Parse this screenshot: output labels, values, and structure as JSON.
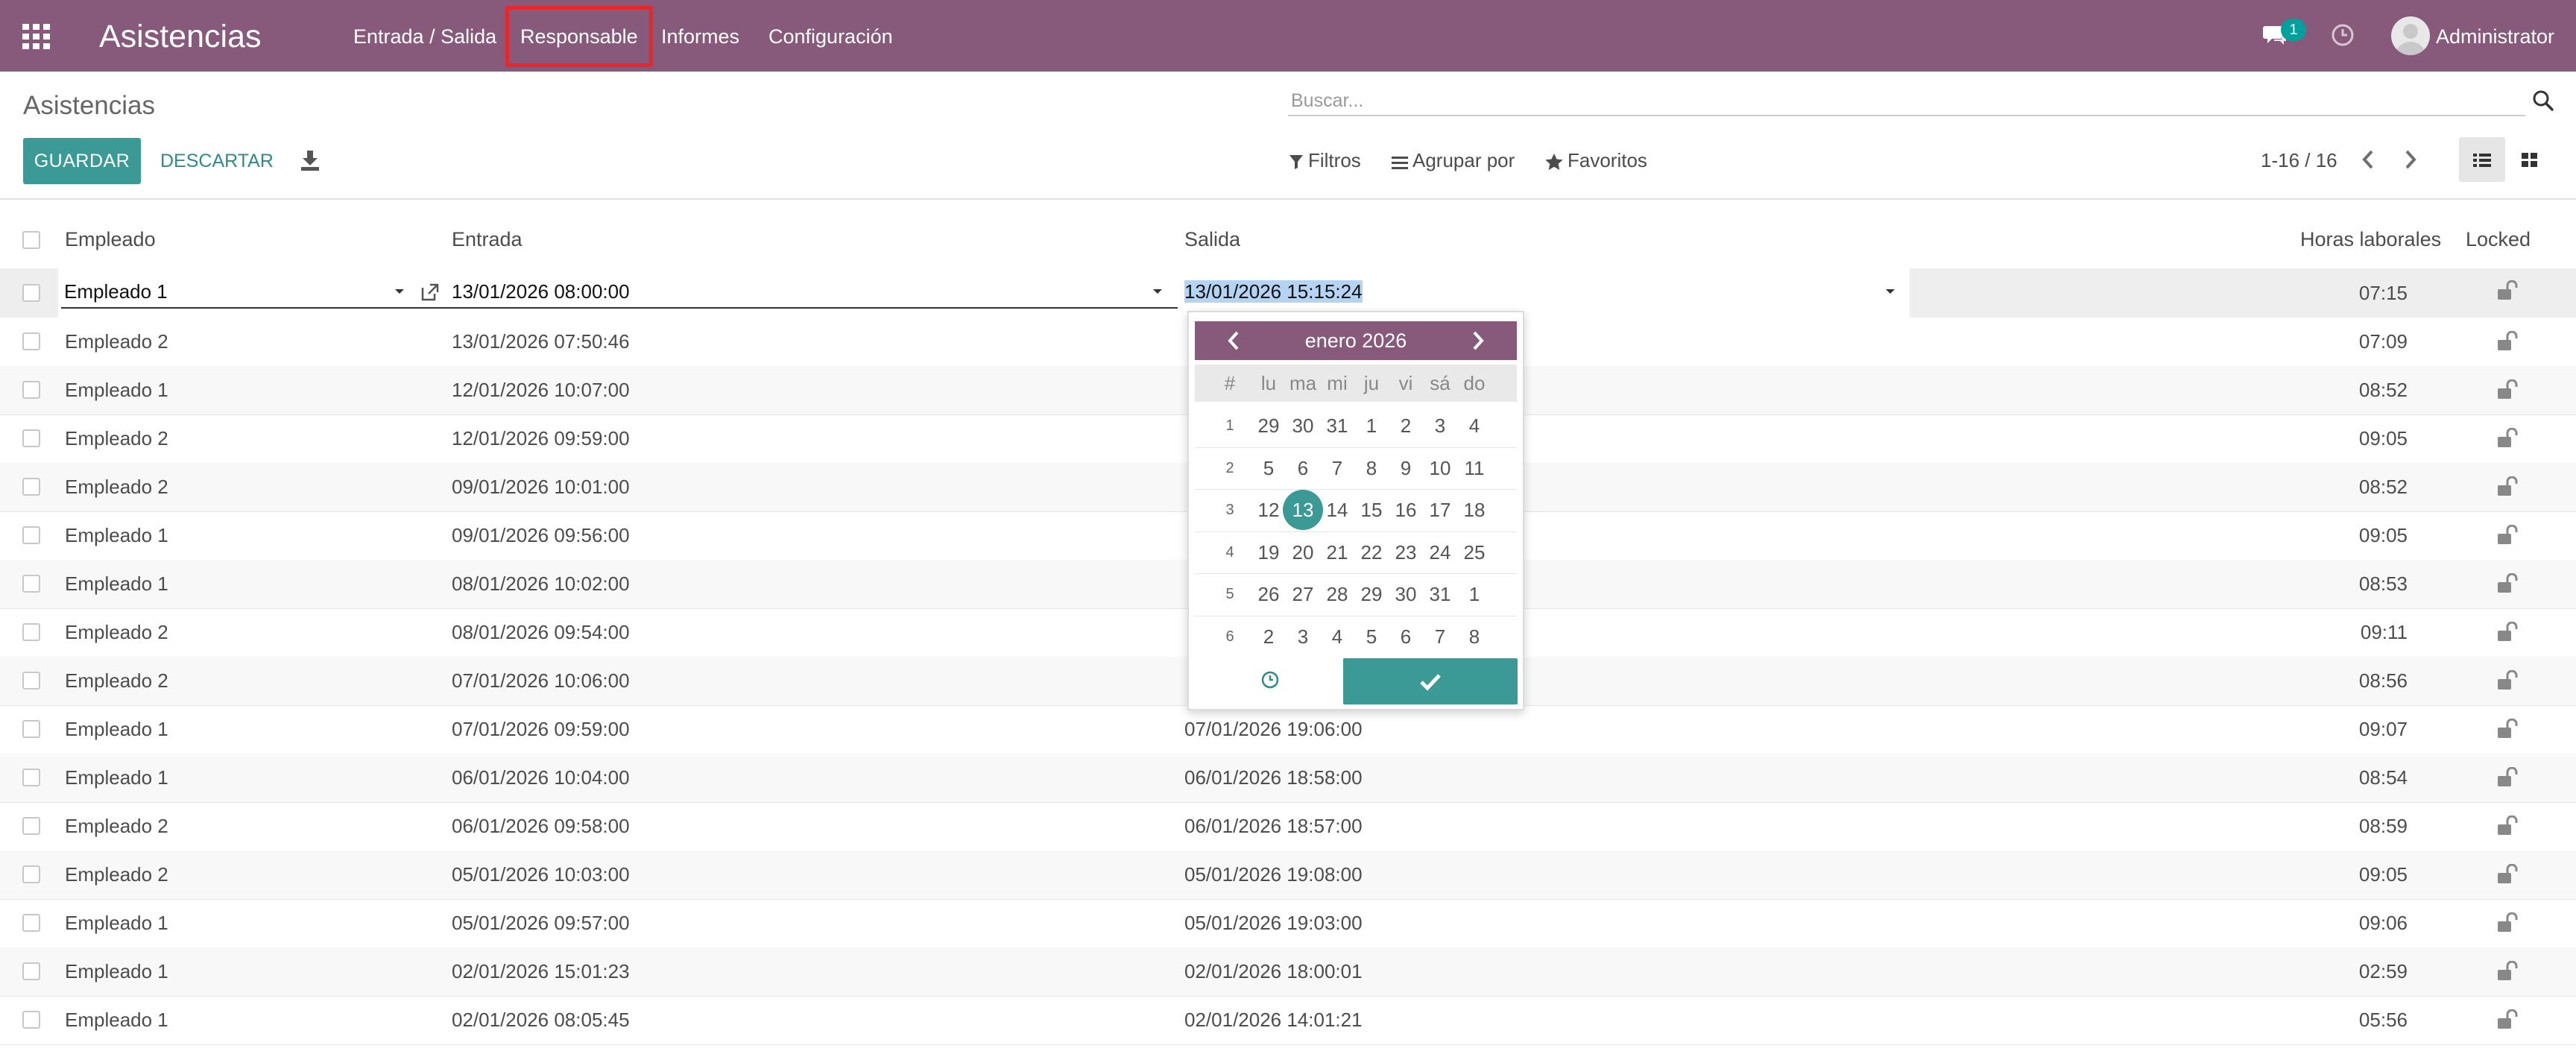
{
  "navbar": {
    "app_title": "Asistencias",
    "menu": [
      "Entrada / Salida",
      "Responsable",
      "Informes",
      "Configuración"
    ],
    "highlighted_menu": "Responsable",
    "chat_badge": "1",
    "user": "Administrator"
  },
  "control_panel": {
    "breadcrumb": "Asistencias",
    "search_placeholder": "Buscar...",
    "save_label": "GUARDAR",
    "discard_label": "DESCARTAR",
    "filters_label": "Filtros",
    "group_by_label": "Agrupar por",
    "favorites_label": "Favoritos",
    "pager": "1-16 / 16"
  },
  "table": {
    "columns": {
      "employee": "Empleado",
      "check_in": "Entrada",
      "check_out": "Salida",
      "worked_hours": "Horas laborales",
      "locked": "Locked"
    },
    "editing_row": {
      "employee": "Empleado 1",
      "check_in": "13/01/2026 08:00:00",
      "check_out": "13/01/2026 15:15:24",
      "worked_hours": "07:15"
    },
    "rows": [
      {
        "employee": "Empleado 2",
        "check_in": "13/01/2026 07:50:46",
        "check_out": "",
        "worked_hours": "07:09"
      },
      {
        "employee": "Empleado 1",
        "check_in": "12/01/2026 10:07:00",
        "check_out": "",
        "worked_hours": "08:52"
      },
      {
        "employee": "Empleado 2",
        "check_in": "12/01/2026 09:59:00",
        "check_out": "",
        "worked_hours": "09:05"
      },
      {
        "employee": "Empleado 2",
        "check_in": "09/01/2026 10:01:00",
        "check_out": "",
        "worked_hours": "08:52"
      },
      {
        "employee": "Empleado 1",
        "check_in": "09/01/2026 09:56:00",
        "check_out": "",
        "worked_hours": "09:05"
      },
      {
        "employee": "Empleado 1",
        "check_in": "08/01/2026 10:02:00",
        "check_out": "",
        "worked_hours": "08:53"
      },
      {
        "employee": "Empleado 2",
        "check_in": "08/01/2026 09:54:00",
        "check_out": "",
        "worked_hours": "09:11"
      },
      {
        "employee": "Empleado 2",
        "check_in": "07/01/2026 10:06:00",
        "check_out": "",
        "worked_hours": "08:56"
      },
      {
        "employee": "Empleado 1",
        "check_in": "07/01/2026 09:59:00",
        "check_out": "07/01/2026 19:06:00",
        "worked_hours": "09:07"
      },
      {
        "employee": "Empleado 1",
        "check_in": "06/01/2026 10:04:00",
        "check_out": "06/01/2026 18:58:00",
        "worked_hours": "08:54"
      },
      {
        "employee": "Empleado 2",
        "check_in": "06/01/2026 09:58:00",
        "check_out": "06/01/2026 18:57:00",
        "worked_hours": "08:59"
      },
      {
        "employee": "Empleado 2",
        "check_in": "05/01/2026 10:03:00",
        "check_out": "05/01/2026 19:08:00",
        "worked_hours": "09:05"
      },
      {
        "employee": "Empleado 1",
        "check_in": "05/01/2026 09:57:00",
        "check_out": "05/01/2026 19:03:00",
        "worked_hours": "09:06"
      },
      {
        "employee": "Empleado 1",
        "check_in": "02/01/2026 15:01:23",
        "check_out": "02/01/2026 18:00:01",
        "worked_hours": "02:59"
      },
      {
        "employee": "Empleado 1",
        "check_in": "02/01/2026 08:05:45",
        "check_out": "02/01/2026 14:01:21",
        "worked_hours": "05:56"
      }
    ]
  },
  "datepicker": {
    "month": "enero 2026",
    "week_header": "#",
    "weekdays": [
      "lu",
      "ma",
      "mi",
      "ju",
      "vi",
      "sá",
      "do"
    ],
    "weeks": [
      {
        "num": "1",
        "days": [
          "29",
          "30",
          "31",
          "1",
          "2",
          "3",
          "4"
        ]
      },
      {
        "num": "2",
        "days": [
          "5",
          "6",
          "7",
          "8",
          "9",
          "10",
          "11"
        ]
      },
      {
        "num": "3",
        "days": [
          "12",
          "13",
          "14",
          "15",
          "16",
          "17",
          "18"
        ]
      },
      {
        "num": "4",
        "days": [
          "19",
          "20",
          "21",
          "22",
          "23",
          "24",
          "25"
        ]
      },
      {
        "num": "5",
        "days": [
          "26",
          "27",
          "28",
          "29",
          "30",
          "31",
          "1"
        ]
      },
      {
        "num": "6",
        "days": [
          "2",
          "3",
          "4",
          "5",
          "6",
          "7",
          "8"
        ]
      }
    ],
    "selected_day": "13"
  },
  "colors": {
    "brand": "#875a7b",
    "primary": "#3b9a95",
    "highlight_box": "#e8262b",
    "badge": "#00a09d"
  },
  "icons": [
    "apps-grid-icon",
    "chat-icon",
    "clock-icon",
    "search-icon",
    "download-icon",
    "filter-icon",
    "group-by-icon",
    "star-icon",
    "chevron-left-icon",
    "chevron-right-icon",
    "list-view-icon",
    "kanban-view-icon",
    "unlock-icon",
    "external-link-icon",
    "caret-down-icon",
    "check-icon"
  ]
}
